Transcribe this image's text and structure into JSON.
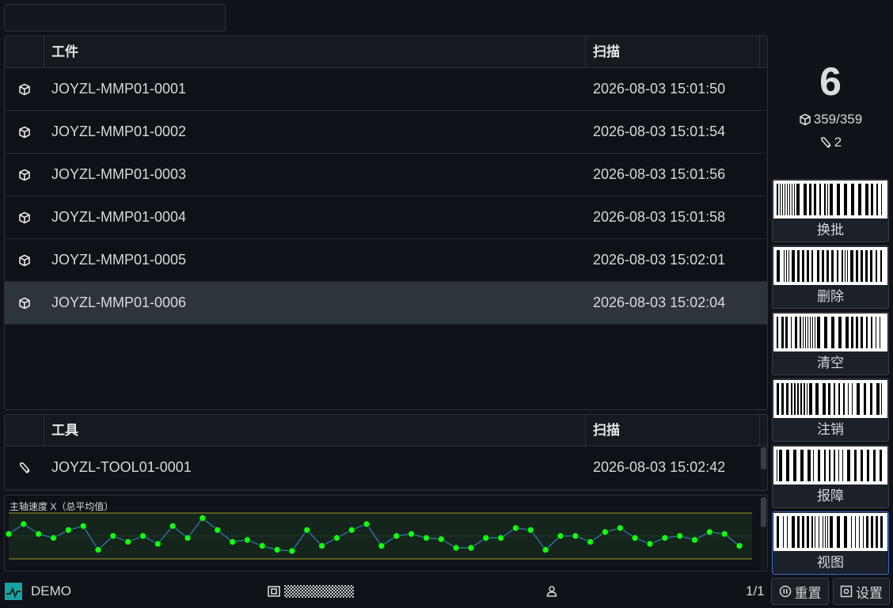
{
  "search": {
    "value": "",
    "placeholder": ""
  },
  "parts_table": {
    "headers": {
      "name": "工件",
      "time": "扫描"
    },
    "rows": [
      {
        "icon": "cube-icon",
        "name": "JOYZL-MMP01-0001",
        "time": "2026-08-03 15:01:50"
      },
      {
        "icon": "cube-icon",
        "name": "JOYZL-MMP01-0002",
        "time": "2026-08-03 15:01:54"
      },
      {
        "icon": "cube-icon",
        "name": "JOYZL-MMP01-0003",
        "time": "2026-08-03 15:01:56"
      },
      {
        "icon": "cube-icon",
        "name": "JOYZL-MMP01-0004",
        "time": "2026-08-03 15:01:58"
      },
      {
        "icon": "cube-icon",
        "name": "JOYZL-MMP01-0005",
        "time": "2026-08-03 15:02:01"
      },
      {
        "icon": "cube-icon",
        "name": "JOYZL-MMP01-0006",
        "time": "2026-08-03 15:02:04",
        "selected": true
      }
    ]
  },
  "tools_table": {
    "headers": {
      "name": "工具",
      "time": "扫描"
    },
    "rows": [
      {
        "icon": "tool-icon",
        "name": "JOYZL-TOOL01-0001",
        "time": "2026-08-03 15:02:42"
      }
    ]
  },
  "summary": {
    "count": "6",
    "parts": "359/359",
    "tools": "2"
  },
  "barcode_buttons": [
    {
      "label": "换批"
    },
    {
      "label": "删除"
    },
    {
      "label": "清空"
    },
    {
      "label": "注销"
    },
    {
      "label": "报障"
    },
    {
      "label": "视图",
      "active": true
    }
  ],
  "chart_data": {
    "type": "line",
    "title": "主轴速度 X（总平均值）",
    "x": [
      1,
      2,
      3,
      4,
      5,
      6,
      7,
      8,
      9,
      10,
      11,
      12,
      13,
      14,
      15,
      16,
      17,
      18,
      19,
      20,
      21,
      22,
      23,
      24,
      25,
      26,
      27,
      28,
      29,
      30,
      31,
      32,
      33,
      34,
      35,
      36,
      37,
      38,
      39,
      40,
      41,
      42,
      43,
      44,
      45,
      46,
      47,
      48,
      49,
      50
    ],
    "series": [
      {
        "values": [
          0.55,
          0.8,
          0.55,
          0.45,
          0.65,
          0.75,
          0.15,
          0.5,
          0.35,
          0.5,
          0.3,
          0.75,
          0.45,
          0.95,
          0.65,
          0.35,
          0.4,
          0.25,
          0.15,
          0.12,
          0.65,
          0.25,
          0.45,
          0.65,
          0.8,
          0.25,
          0.5,
          0.55,
          0.45,
          0.42,
          0.2,
          0.2,
          0.45,
          0.45,
          0.7,
          0.65,
          0.15,
          0.5,
          0.5,
          0.35,
          0.6,
          0.7,
          0.45,
          0.3,
          0.45,
          0.5,
          0.4,
          0.6,
          0.55,
          0.25
        ]
      }
    ],
    "ylim": [
      0,
      1
    ],
    "colors": {
      "line": "#2f7fbf",
      "point": "#14ff14",
      "band": "#16251c",
      "limit": "#9a9a2a"
    },
    "grid": false
  },
  "statusbar": {
    "app_name": "DEMO",
    "page": "1/1",
    "reset_label": "重置",
    "settings_label": "设置"
  }
}
